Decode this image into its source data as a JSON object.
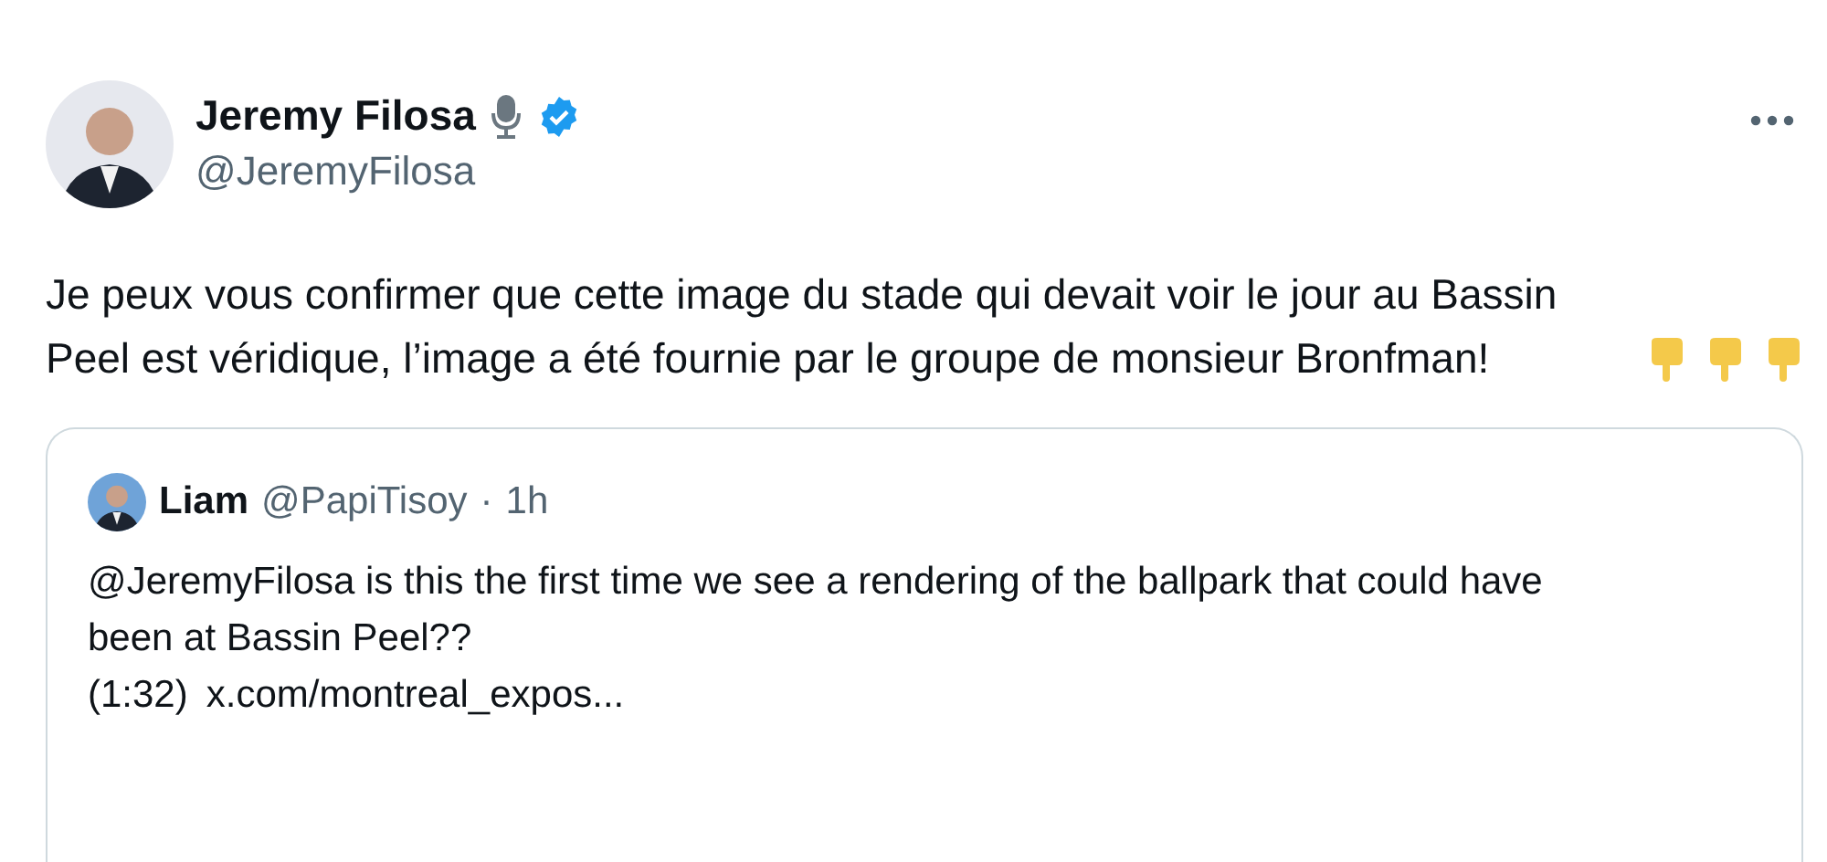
{
  "author": {
    "name": "Jeremy Filosa",
    "handle": "@JeremyFilosa",
    "verified": true
  },
  "text": "Je peux vous confirmer que cette image du stade qui devait voir le jour au Bassin Peel est véridique, l’image a été fournie par le groupe de monsieur Bronfman!",
  "quote": {
    "name": "Liam",
    "handle": "@PapiTisoy",
    "separator": "·",
    "time": "1h",
    "text": "@JeremyFilosa is this the first time we see a rendering of the ballpark that could have been at Bassin Peel??",
    "duration": "(1:32)",
    "link": "x.com/montreal_expos..."
  }
}
